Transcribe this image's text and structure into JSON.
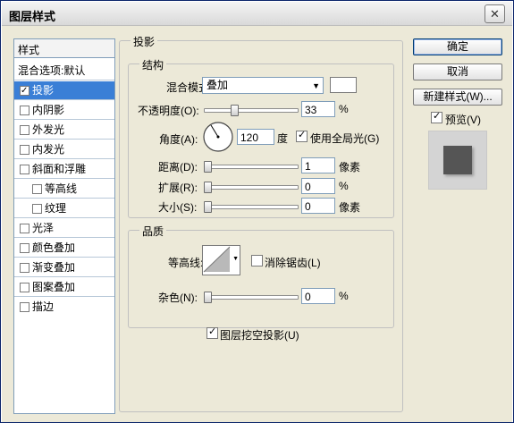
{
  "window": {
    "title": "图层样式",
    "close_glyph": "✕"
  },
  "style_list": {
    "header": "样式",
    "blend_options": "混合选项:默认",
    "items": [
      {
        "label": "投影",
        "checked": true,
        "selected": true
      },
      {
        "label": "内阴影",
        "checked": false
      },
      {
        "label": "外发光",
        "checked": false
      },
      {
        "label": "内发光",
        "checked": false
      },
      {
        "label": "斜面和浮雕",
        "checked": false
      },
      {
        "label": "等高线",
        "checked": false
      },
      {
        "label": "纹理",
        "checked": false
      },
      {
        "label": "光泽",
        "checked": false
      },
      {
        "label": "颜色叠加",
        "checked": false
      },
      {
        "label": "渐变叠加",
        "checked": false
      },
      {
        "label": "图案叠加",
        "checked": false
      },
      {
        "label": "描边",
        "checked": false
      }
    ]
  },
  "buttons": {
    "ok": "确定",
    "cancel": "取消",
    "new_style": "新建样式(W)...",
    "preview": "预览(V)"
  },
  "drop_shadow": {
    "title": "投影",
    "structure": {
      "title": "结构",
      "blend_mode_label": "混合模式:",
      "blend_mode_value": "叠加",
      "shadow_color": "#ffffff",
      "opacity_label": "不透明度(O):",
      "opacity_value": "33",
      "opacity_unit": "%",
      "opacity_level": 0.33,
      "angle_label": "角度(A):",
      "angle_value": "120",
      "angle_unit": "度",
      "global_light_label": "使用全局光(G)",
      "global_light_checked": true,
      "distance_label": "距离(D):",
      "distance_value": "1",
      "distance_unit": "像素",
      "spread_label": "扩展(R):",
      "spread_value": "0",
      "spread_unit": "%",
      "size_label": "大小(S):",
      "size_value": "0",
      "size_unit": "像素"
    },
    "quality": {
      "title": "品质",
      "contour_label": "等高线:",
      "anti_alias_label": "消除锯齿(L)",
      "anti_alias_checked": false,
      "noise_label": "杂色(N):",
      "noise_value": "0",
      "noise_unit": "%"
    },
    "knockout_label": "图层挖空投影(U)",
    "knockout_checked": true
  }
}
